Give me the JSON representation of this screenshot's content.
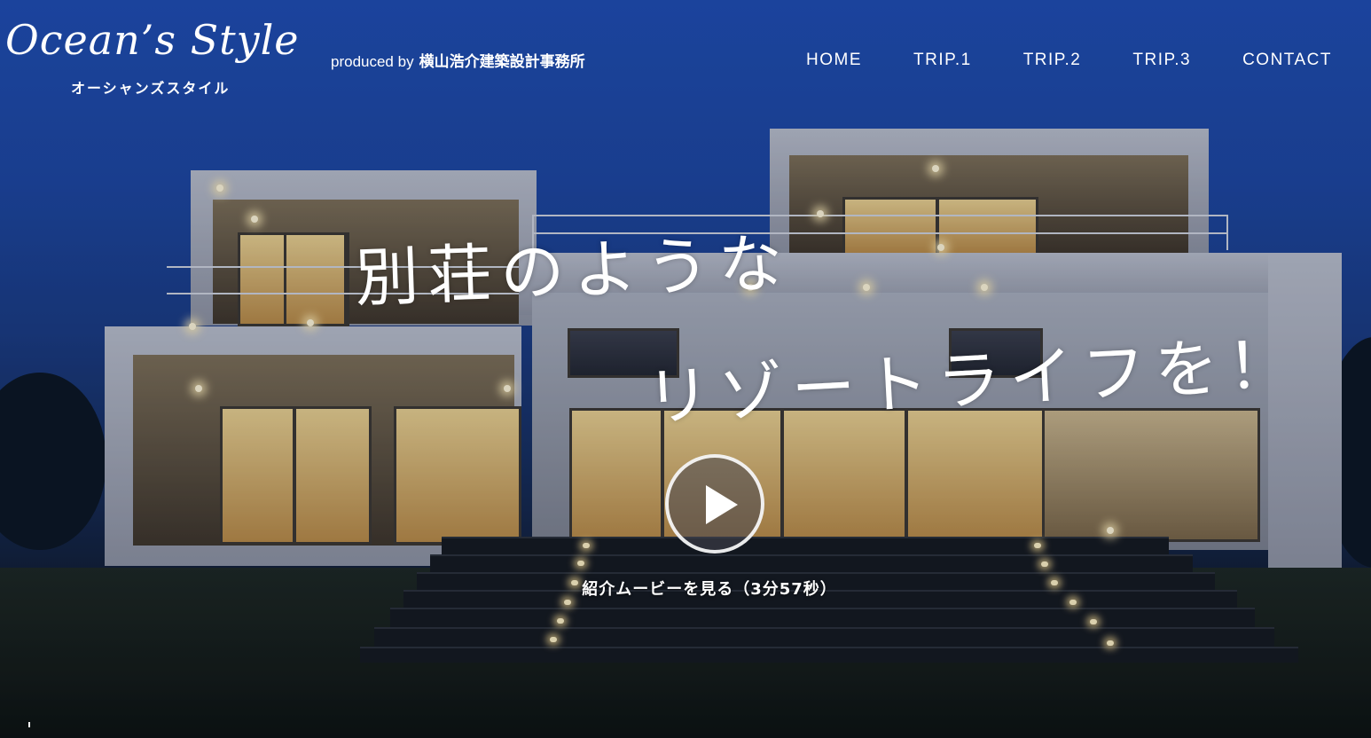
{
  "logo": {
    "main": "Ocean’s Style",
    "sub": "オーシャンズスタイル"
  },
  "produced": {
    "by": "produced by",
    "firm": "横山浩介建築設計事務所"
  },
  "nav": {
    "items": [
      "HOME",
      "TRIP.1",
      "TRIP.2",
      "TRIP.3",
      "CONTACT"
    ]
  },
  "hero": {
    "headline_line1": "別荘のような",
    "headline_line2": "リゾートライフを！",
    "movie_label": "紹介ムービーを見る（3分57秒）"
  },
  "colors": {
    "sky": "#1f4cb0",
    "text": "#ffffff",
    "window_light": "#e9cf8e"
  },
  "icons": {
    "play": "play-icon"
  }
}
